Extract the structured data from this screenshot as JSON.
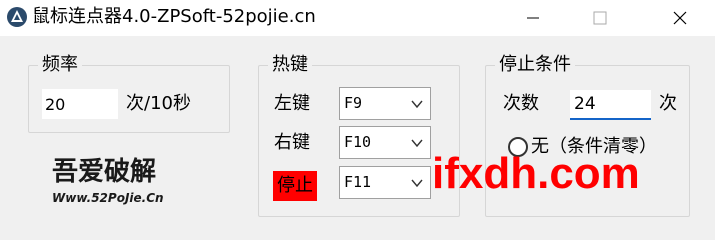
{
  "window": {
    "title": "鼠标连点器4.0-ZPSoft-52pojie.cn",
    "buttons": [
      "minimize-icon",
      "maximize-icon",
      "close-icon"
    ]
  },
  "frequency": {
    "group_title": "频率",
    "value": "20",
    "unit": "次/10秒"
  },
  "hotkeys": {
    "group_title": "热键",
    "left_label": "左键",
    "left_value": "F9",
    "right_label": "右键",
    "right_value": "F10",
    "stop_label": "停止",
    "stop_value": "F11"
  },
  "stop_condition": {
    "group_title": "停止条件",
    "count_label": "次数",
    "count_value": "24",
    "count_unit": "次",
    "radio_label": "无（条件清零）"
  },
  "logo": {
    "text_main": "吾爱破解",
    "text_url": "Www.52PoJie.Cn"
  },
  "watermark": "ifxdh.com",
  "colors": {
    "stop_bg": "#ff0000",
    "watermark": "#ff0000",
    "input_focus": "#1464c8"
  }
}
